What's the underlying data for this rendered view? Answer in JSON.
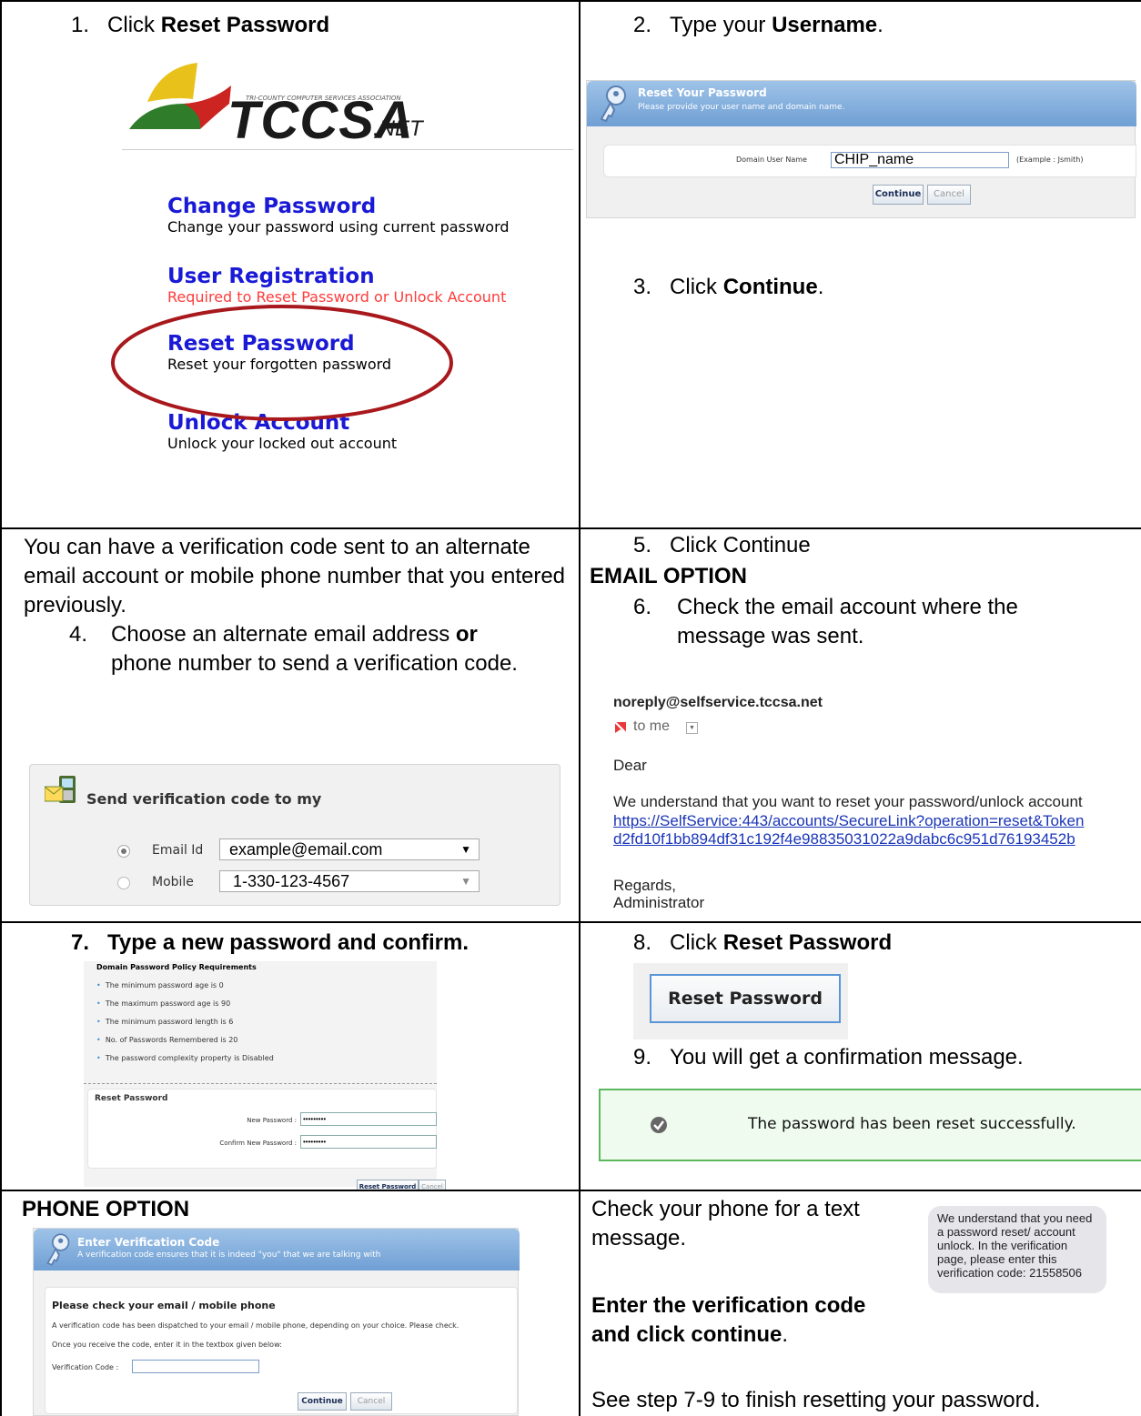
{
  "c1": {
    "step1_num": "1.",
    "step1_text": "Click ",
    "step1_bold": "Reset Password",
    "logo_text": "TCCSA",
    "logo_suffix": ".NET",
    "menu": [
      {
        "title": "Change Password",
        "desc": "Change your password using current password",
        "desc_color": "#000000"
      },
      {
        "title": "User Registration",
        "desc": "Required to Reset Password or Unlock Account",
        "desc_color": "#ff3b3b"
      },
      {
        "title": "Reset Password",
        "desc": "Reset your forgotten password",
        "desc_color": "#000000"
      },
      {
        "title": "Unlock Account",
        "desc": "Unlock your locked out account",
        "desc_color": "#000000"
      }
    ]
  },
  "c2": {
    "step2_num": "2.",
    "step2_text": "Type your ",
    "step2_bold": "Username",
    "step2_end": ".",
    "panel_title": "Reset Your Password",
    "panel_sub": "Please provide your user name and domain name.",
    "field_label": "Domain User Name",
    "field_value": "CHIP_name",
    "field_example": "(Example : Jsmith)",
    "continue_btn": "Continue",
    "cancel_btn": "Cancel",
    "step3_num": "3.",
    "step3_text": "Click ",
    "step3_bold": "Continue",
    "step3_end": "."
  },
  "c3": {
    "intro": "You can have a verification code sent to an alternate email account or mobile phone number that you entered previously.",
    "step4_num": "4.",
    "step4_a": "Choose an alternate email address ",
    "step4_or": "or",
    "step4_b": " phone number to send a verification code.",
    "box_title": "Send verification code to my",
    "email_label": "Email Id",
    "email_value": "example@email.com",
    "mobile_label": "Mobile",
    "mobile_value": "1-330-123-4567"
  },
  "c4": {
    "step5": "5.   Click Continue",
    "email_option": "EMAIL OPTION",
    "step6_num": "6.",
    "step6_text": "Check the email account where the message was sent.",
    "sender": "noreply@selfservice.tccsa.net",
    "to_me": "to me",
    "dear": "Dear",
    "body": "We understand that you want to reset your password/unlock account",
    "link1": "https://SelfService:443/accounts/SecureLink?operation=reset&Token",
    "link2": "d2fd10f1bb894df31c192f4e98835031022a9dabc6c951d76193452b",
    "regards": "Regards,",
    "admin": "Administrator"
  },
  "c5": {
    "step7_num": "7.",
    "step7_text": "Type a new password and confirm.",
    "policy_title": "Domain Password Policy Requirements",
    "policies": [
      "The minimum password age is 0",
      "The maximum password age is 90",
      "The minimum password length is 6",
      "No. of Passwords Remembered is 20",
      "The password complexity property is Disabled"
    ],
    "reset_heading": "Reset Password",
    "new_pw_label": "New Password :",
    "confirm_pw_label": "Confirm New Password :",
    "pw_mask": "•••••••••",
    "reset_btn": "Reset Password",
    "cancel_btn": "Cancel"
  },
  "c6": {
    "step8_num": "8.",
    "step8_text": "Click ",
    "step8_bold": "Reset Password",
    "big_reset_btn": "Reset Password",
    "step9_num": "9.",
    "step9_text": "You will get a confirmation message.",
    "success_msg": "The password has been reset successfully."
  },
  "c7": {
    "phone_option": "PHONE OPTION",
    "panel_title": "Enter Verification Code",
    "panel_sub": "A verification code ensures that it is indeed \"you\" that we are talking with",
    "check_title": "Please check your email / mobile phone",
    "line1": "A verification code has been dispatched to your email / mobile phone, depending on your choice. Please check.",
    "line2": "Once you receive the code, enter it in the textbox given below:",
    "code_label": "Verification Code :",
    "continue_btn": "Continue",
    "cancel_btn": "Cancel"
  },
  "c8": {
    "check_phone": "Check your phone for a text message.",
    "enter_code": "Enter the verification code and click continue",
    "enter_end": ".",
    "see_step": "See step 7-9 to finish resetting your password.",
    "sms": "We understand that you need a password reset/ account unlock. In the verification page, please enter this verification code: 21558506"
  },
  "colors": {
    "accent_blue": "#1919d6",
    "ellipse_red": "#a8181c",
    "success_green": "#5cb85c"
  }
}
